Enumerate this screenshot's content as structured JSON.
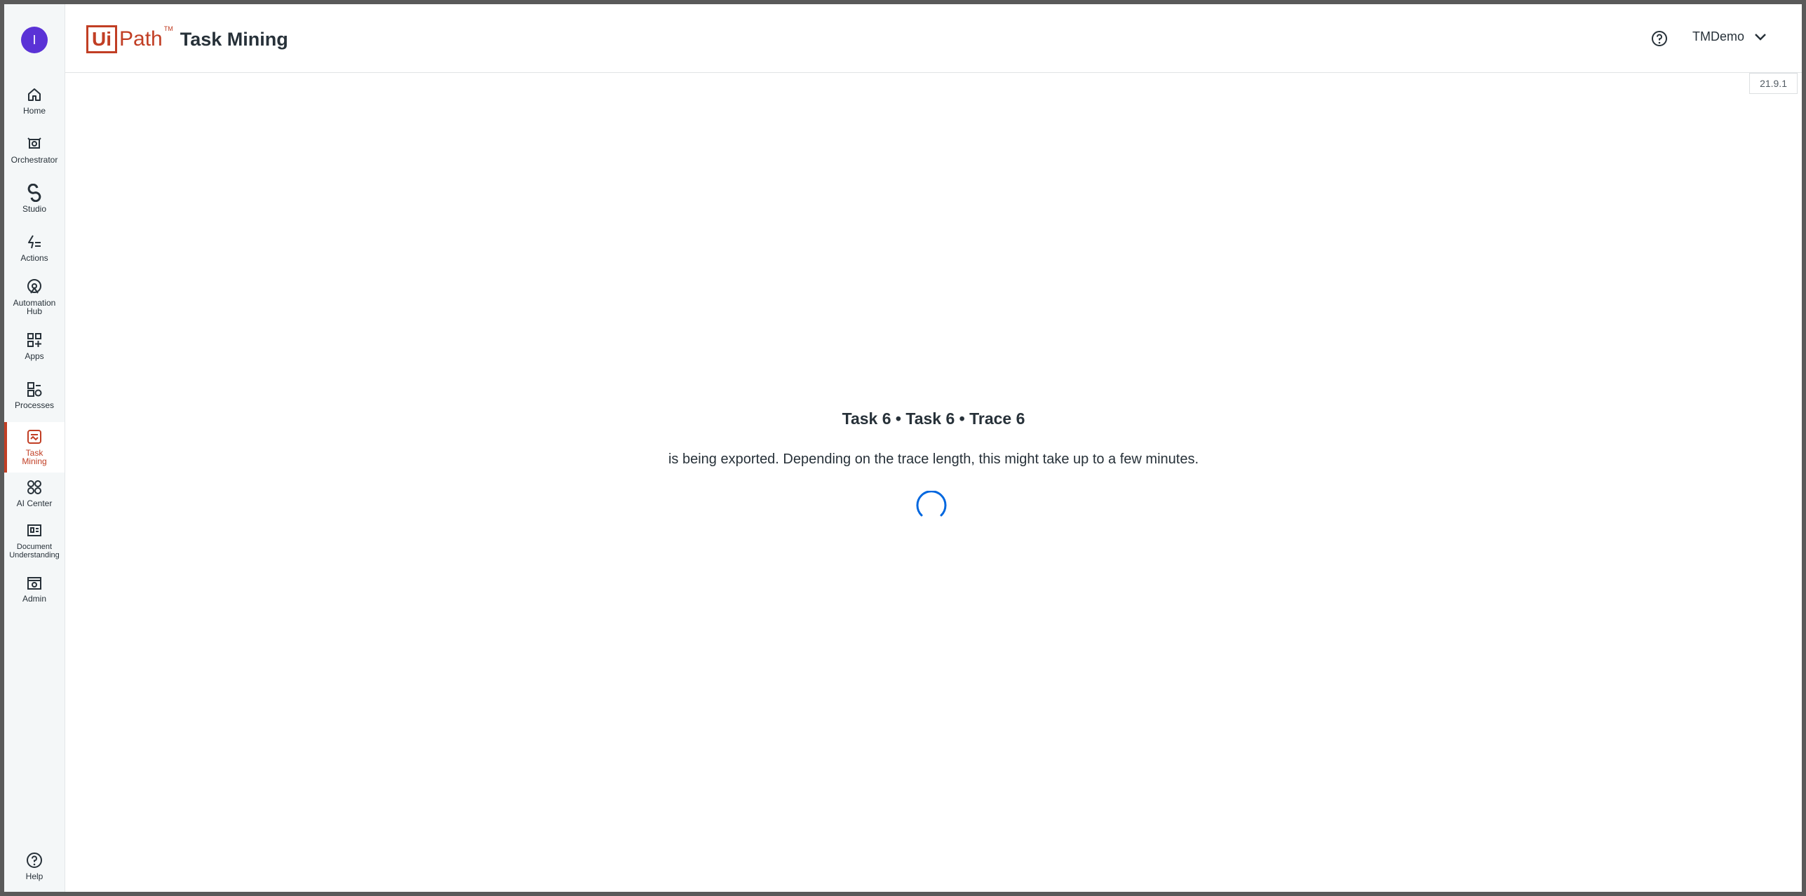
{
  "user": {
    "avatar_initial": "I"
  },
  "nav": {
    "items": [
      {
        "label": "Home",
        "icon": "home-icon"
      },
      {
        "label": "Orchestrator",
        "icon": "orchestrator-icon"
      },
      {
        "label": "Studio",
        "icon": "studio-icon"
      },
      {
        "label": "Actions",
        "icon": "actions-icon"
      },
      {
        "label": "Automation Hub",
        "icon": "automation-hub-icon"
      },
      {
        "label": "Apps",
        "icon": "apps-icon"
      },
      {
        "label": "Processes",
        "icon": "processes-icon"
      },
      {
        "label": "Task Mining",
        "icon": "task-mining-icon",
        "active": true
      },
      {
        "label": "AI Center",
        "icon": "ai-center-icon"
      },
      {
        "label": "Document Understanding",
        "icon": "document-understanding-icon"
      },
      {
        "label": "Admin",
        "icon": "admin-icon"
      }
    ],
    "help_label": "Help"
  },
  "header": {
    "logo_ui": "Ui",
    "logo_path": "Path",
    "logo_tm": "TM",
    "product": "Task Mining",
    "tenant": "TMDemo",
    "version": "21.9.1"
  },
  "main": {
    "title": "Task 6 • Task 6 • Trace 6",
    "message": "is being exported. Depending on the trace length, this might take up to a few minutes."
  },
  "colors": {
    "accent": "#c13e24",
    "avatar": "#5a32d6",
    "spinner": "#0067df",
    "text": "#273139"
  }
}
